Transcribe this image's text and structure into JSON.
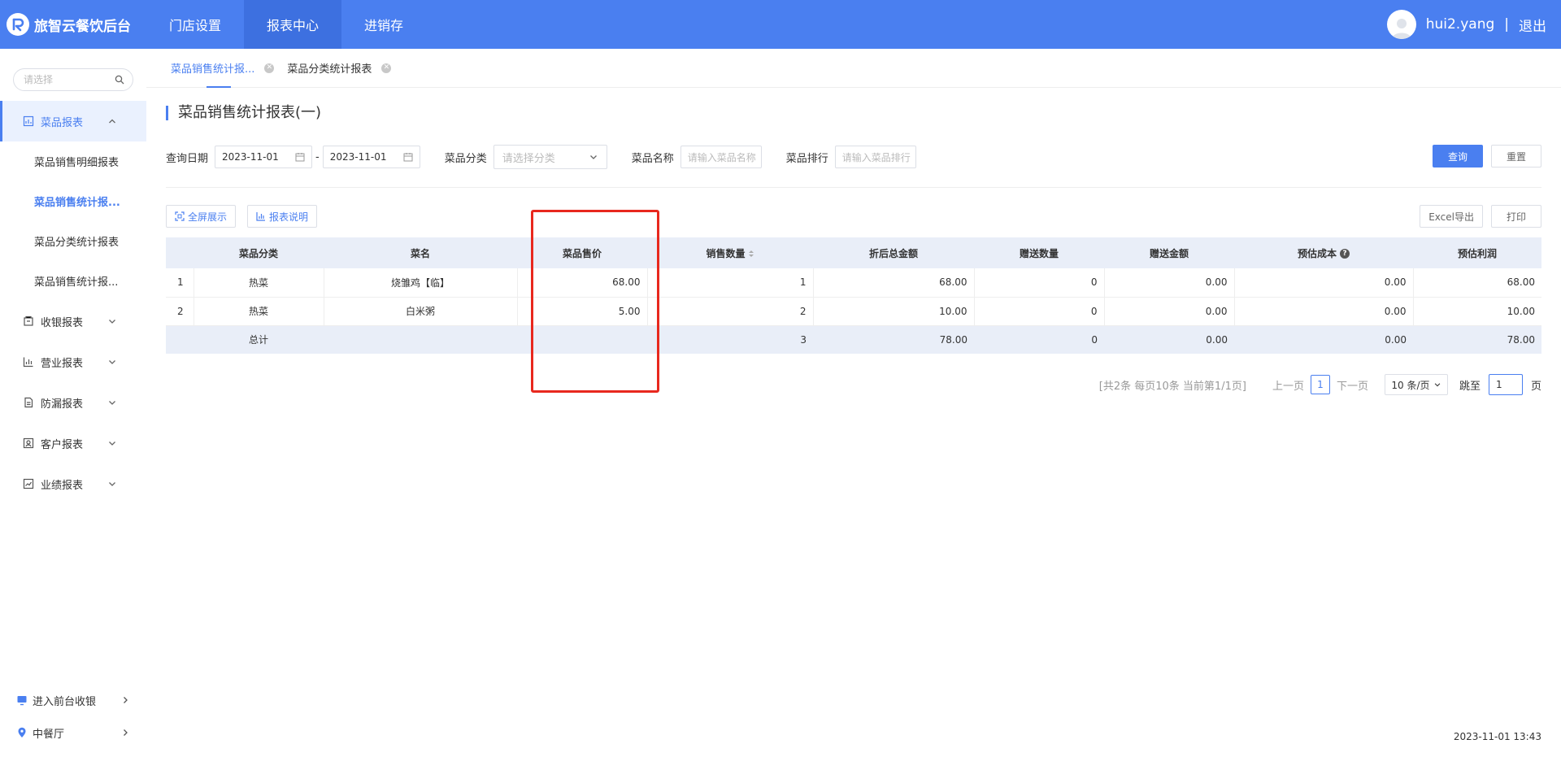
{
  "brand": {
    "title": "旅智云餐饮后台"
  },
  "nav": [
    {
      "label": "门店设置"
    },
    {
      "label": "报表中心"
    },
    {
      "label": "进销存"
    }
  ],
  "user": {
    "name": "hui2.yang",
    "separator": "|",
    "logout": "退出"
  },
  "sidebar": {
    "search_placeholder": "请选择",
    "groups": [
      {
        "label": "菜品报表",
        "open": true,
        "items": [
          {
            "label": "菜品销售明细报表"
          },
          {
            "label": "菜品销售统计报..."
          },
          {
            "label": "菜品分类统计报表"
          },
          {
            "label": "菜品销售统计报..."
          }
        ]
      },
      {
        "label": "收银报表"
      },
      {
        "label": "营业报表"
      },
      {
        "label": "防漏报表"
      },
      {
        "label": "客户报表"
      },
      {
        "label": "业绩报表"
      }
    ],
    "bottom": [
      {
        "label": "进入前台收银"
      },
      {
        "label": "中餐厅"
      }
    ]
  },
  "tabs": [
    {
      "label": "菜品销售统计报..."
    },
    {
      "label": "菜品分类统计报表"
    }
  ],
  "page": {
    "title": "菜品销售统计报表(一)"
  },
  "filters": {
    "date_label": "查询日期",
    "date_from": "2023-11-01",
    "date_sep": "-",
    "date_to": "2023-11-01",
    "category_label": "菜品分类",
    "category_placeholder": "请选择分类",
    "name_label": "菜品名称",
    "name_placeholder": "请输入菜品名称",
    "rank_label": "菜品排行",
    "rank_placeholder": "请输入菜品排行",
    "query_button": "查询",
    "reset_button": "重置"
  },
  "toolbar": {
    "fullscreen": "全屏展示",
    "report_desc": "报表说明",
    "excel": "Excel导出",
    "print": "打印"
  },
  "table": {
    "headers": [
      "菜品分类",
      "菜名",
      "菜品售价",
      "销售数量",
      "折后总金额",
      "赠送数量",
      "赠送金额",
      "预估成本",
      "预估利润"
    ],
    "rows": [
      {
        "index": "1",
        "category": "热菜",
        "name": "烧雏鸡【临】",
        "price": "68.00",
        "qty": "1",
        "amount": "68.00",
        "gift_qty": "0",
        "gift_amount": "0.00",
        "cost": "0.00",
        "profit": "68.00"
      },
      {
        "index": "2",
        "category": "热菜",
        "name": "白米粥",
        "price": "5.00",
        "qty": "2",
        "amount": "10.00",
        "gift_qty": "0",
        "gift_amount": "0.00",
        "cost": "0.00",
        "profit": "10.00"
      }
    ],
    "total": {
      "label": "总计",
      "qty": "3",
      "amount": "78.00",
      "gift_qty": "0",
      "gift_amount": "0.00",
      "cost": "0.00",
      "profit": "78.00"
    }
  },
  "pagination": {
    "summary": "[共2条 每页10条 当前第1/1页]",
    "prev": "上一页",
    "current": "1",
    "next": "下一页",
    "page_size": "10 条/页",
    "jump_label": "跳至",
    "jump_value": "1",
    "page_unit": "页"
  },
  "footer": {
    "datetime": "2023-11-01 13:43"
  },
  "colors": {
    "primary": "#4a7ff0",
    "highlight": "#e8281e"
  }
}
